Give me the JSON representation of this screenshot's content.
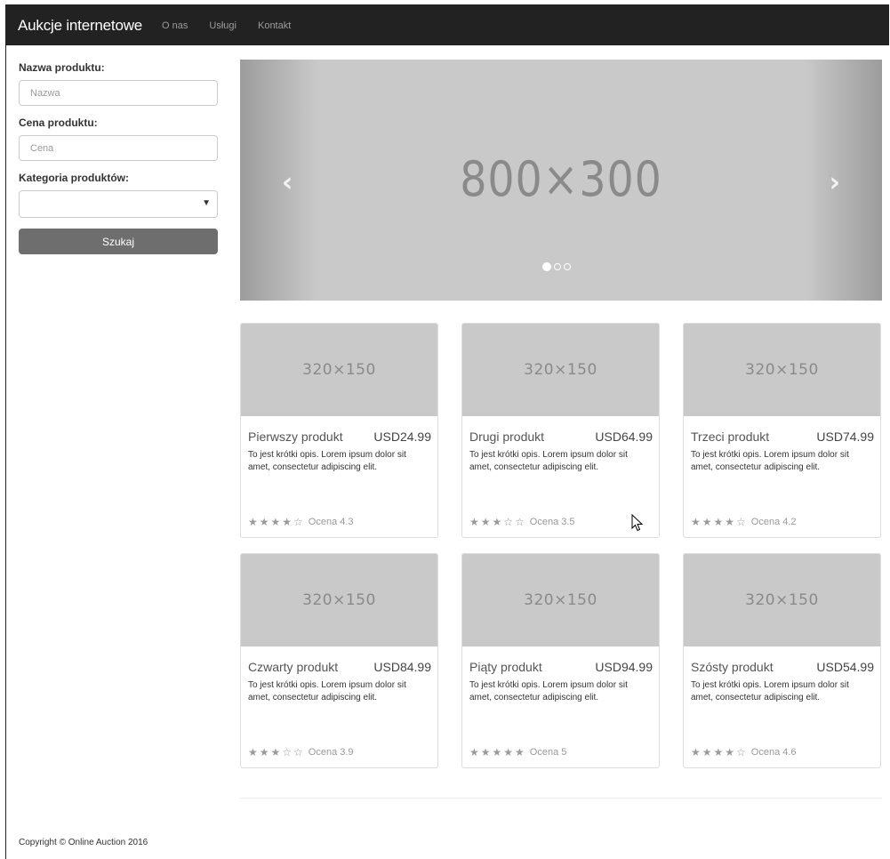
{
  "navbar": {
    "brand": "Aukcje internetowe",
    "links": [
      "O nas",
      "Usługi",
      "Kontakt"
    ]
  },
  "sidebar": {
    "name_label": "Nazwa produktu:",
    "name_placeholder": "Nazwa",
    "price_label": "Cena produktu:",
    "price_placeholder": "Cena",
    "category_label": "Kategoria produktów:",
    "category_value": "",
    "search_label": "Szukaj"
  },
  "carousel": {
    "image_text": "800×300",
    "slide_count": 3,
    "active_slide": 1
  },
  "products": [
    {
      "title": "Pierwszy produkt",
      "price": "USD24.99",
      "desc": "To jest krótki opis. Lorem ipsum dolor sit amet, consectetur adipiscing elit.",
      "image_text": "320×150",
      "stars": 4,
      "rating": "Ocena 4.3"
    },
    {
      "title": "Drugi produkt",
      "price": "USD64.99",
      "desc": "To jest krótki opis. Lorem ipsum dolor sit amet, consectetur adipiscing elit.",
      "image_text": "320×150",
      "stars": 3,
      "rating": "Ocena 3.5"
    },
    {
      "title": "Trzeci produkt",
      "price": "USD74.99",
      "desc": "To jest krótki opis. Lorem ipsum dolor sit amet, consectetur adipiscing elit.",
      "image_text": "320×150",
      "stars": 4,
      "rating": "Ocena 4.2"
    },
    {
      "title": "Czwarty produkt",
      "price": "USD84.99",
      "desc": "To jest krótki opis. Lorem ipsum dolor sit amet, consectetur adipiscing elit.",
      "image_text": "320×150",
      "stars": 3,
      "rating": "Ocena 3.9"
    },
    {
      "title": "Piąty produkt",
      "price": "USD94.99",
      "desc": "To jest krótki opis. Lorem ipsum dolor sit amet, consectetur adipiscing elit.",
      "image_text": "320×150",
      "stars": 5,
      "rating": "Ocena 5"
    },
    {
      "title": "Szósty produkt",
      "price": "USD54.99",
      "desc": "To jest krótki opis. Lorem ipsum dolor sit amet, consectetur adipiscing elit.",
      "image_text": "320×150",
      "stars": 4,
      "rating": "Ocena 4.6"
    }
  ],
  "footer": {
    "copyright": "Copyright © Online Auction 2016"
  },
  "icons": {
    "carousel_prev": "chevron-left-icon",
    "carousel_next": "chevron-right-icon",
    "select_caret": "caret-down-icon",
    "star_full": "★",
    "star_empty": "☆"
  }
}
